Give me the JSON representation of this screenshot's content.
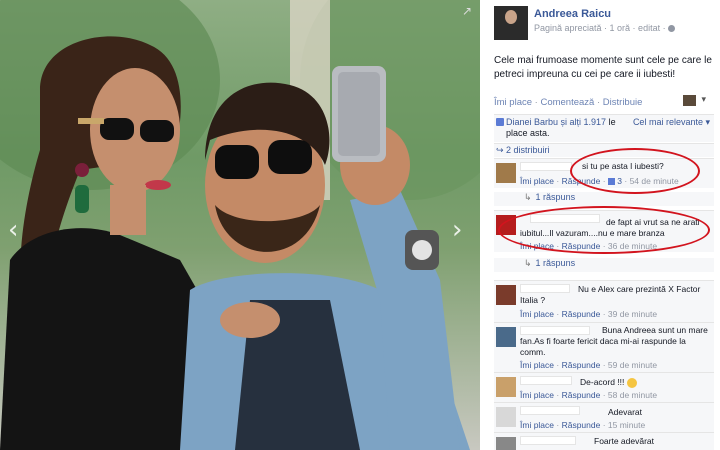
{
  "photo": {
    "expand_icon": "↗",
    "prev_icon": "‹",
    "next_icon": "›"
  },
  "post": {
    "author": "Andreea Raicu",
    "meta": "Pagină apreciată · 1 oră · editat · ",
    "text": "Cele mai frumoase momente sunt cele pe care le petreci impreuna cu cei pe care ii iubesti!",
    "actions": {
      "like": "Îmi place",
      "comment": "Comentează",
      "share": "Distribuie"
    },
    "likes": {
      "text_link": "Dianei Barbu și alți 1.917",
      "text_rest": " le place asta.",
      "relevance": "Cel mai relevante ▾"
    },
    "shares": "↪ 2 distribuiri"
  },
  "comments": [
    {
      "text": "si tu pe asta l iubesti?",
      "like": "Îmi place",
      "reply": "Răspunde",
      "likes_count": "3",
      "time": "54 de minute",
      "replies": "1 răspuns"
    },
    {
      "text": "de fapt ai vrut sa ne arati iubitul...Il vazuram....nu e mare branza",
      "like": "Îmi place",
      "reply": "Răspunde",
      "time": "36 de minute",
      "replies": "1 răspuns"
    },
    {
      "text": "Nu e Alex care prezintă X Factor Italia ?",
      "like": "Îmi place",
      "reply": "Răspunde",
      "time": "39 de minute"
    },
    {
      "text": "Buna Andreea sunt un mare fan.As fi foarte fericit daca mi-ai raspunde la comm.",
      "like": "Îmi place",
      "reply": "Răspunde",
      "time": "59 de minute"
    },
    {
      "text": "De-acord !!! ",
      "like": "Îmi place",
      "reply": "Răspunde",
      "time": "58 de minute"
    },
    {
      "text": "Adevarat",
      "like": "Îmi place",
      "reply": "Răspunde",
      "time": "15 minute"
    },
    {
      "text": "Foarte adevărat"
    }
  ],
  "colors": {
    "link": "#3b5998",
    "annotation": "#d2141e"
  }
}
